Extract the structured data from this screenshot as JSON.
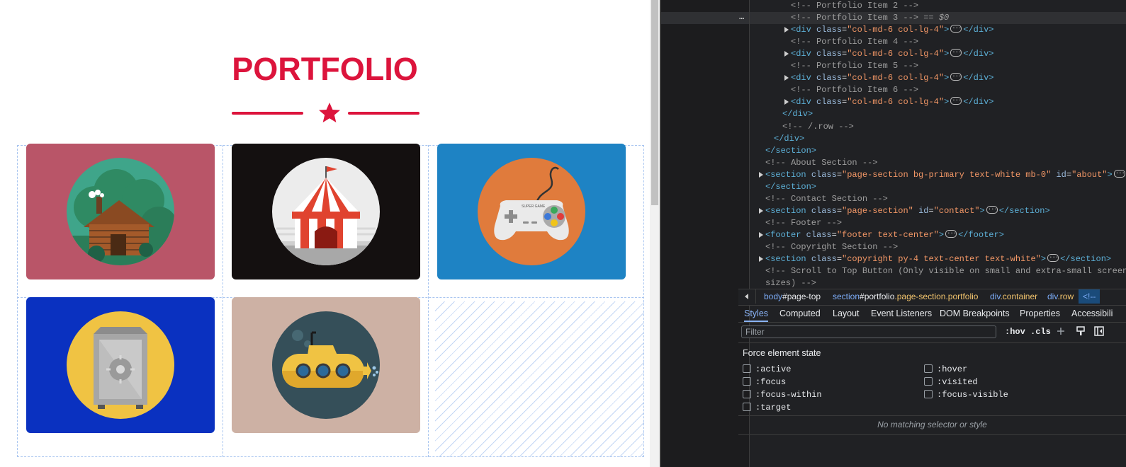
{
  "page": {
    "heading": "PORTFOLIO",
    "accent_color": "#dc143c",
    "divider_icon": "star-icon",
    "portfolio_items": [
      {
        "icon": "cabin-icon",
        "bg": "#b95568"
      },
      {
        "icon": "circus-tent-icon",
        "bg": "#141010"
      },
      {
        "icon": "game-controller-icon",
        "bg": "#1e83c4",
        "controller_text": "SUPER GAME"
      },
      {
        "icon": "safe-icon",
        "bg": "#0a31c0"
      },
      {
        "icon": "submarine-icon",
        "bg": "#cdb1a4"
      }
    ]
  },
  "devtools": {
    "dom_lines": [
      {
        "comment": "<!-- Portfolio Item 2 -->"
      },
      {
        "comment": "<!-- Portfolio Item 3 -->",
        "marker": "== $0"
      },
      {
        "open": "<div",
        "attr": "class",
        "value": "\"col-md-6 col-lg-4\"",
        "close": "</div>"
      },
      {
        "comment": "<!-- Portfolio Item 4 -->"
      },
      {
        "open": "<div",
        "attr": "class",
        "value": "\"col-md-6 col-lg-4\"",
        "close": "</div>"
      },
      {
        "comment": "<!-- Portfolio Item 5 -->"
      },
      {
        "open": "<div",
        "attr": "class",
        "value": "\"col-md-6 col-lg-4\"",
        "close": "</div>"
      },
      {
        "comment": "<!-- Portfolio Item 6 -->"
      },
      {
        "open": "<div",
        "attr": "class",
        "value": "\"col-md-6 col-lg-4\"",
        "close": "</div>"
      },
      {
        "tag": "</div>"
      },
      {
        "comment": "<!-- /.row -->"
      },
      {
        "tag": "</div>"
      },
      {
        "tag": "</section>"
      },
      {
        "comment": "<!-- About Section -->"
      },
      {
        "open": "<section",
        "attr": "class",
        "value": "\"page-section bg-primary text-white mb-0\"",
        "attr2": "id",
        "value2": "\"about\"",
        "close": ">"
      },
      {
        "tag": "</section>"
      },
      {
        "comment": "<!-- Contact Section -->"
      },
      {
        "open": "<section",
        "attr": "class",
        "value": "\"page-section\"",
        "attr2": "id",
        "value2": "\"contact\"",
        "close": "</section>"
      },
      {
        "comment": "<!-- Footer -->"
      },
      {
        "open": "<footer",
        "attr": "class",
        "value": "\"footer text-center\"",
        "close": "</footer>"
      },
      {
        "comment": "<!-- Copyright Section -->"
      },
      {
        "open": "<section",
        "attr": "class",
        "value": "\"copyright py-4 text-center text-white\"",
        "close": "</section>"
      },
      {
        "comment": "<!-- Scroll to Top Button (Only visible on small and extra-small screen"
      },
      {
        "comment": "sizes) -->"
      }
    ],
    "breadcrumbs": {
      "c1_el": "body",
      "c1_id": "#page-top",
      "c2_el": "section",
      "c2_id": "#portfolio",
      "c2_cl": ".page-section.portfolio",
      "c3_el": "div",
      "c3_cl": ".container",
      "c4_el": "div",
      "c4_cl": ".row",
      "c5": "<!--"
    },
    "tabs": [
      "Styles",
      "Computed",
      "Layout",
      "Event Listeners",
      "DOM Breakpoints",
      "Properties",
      "Accessibili"
    ],
    "filter_placeholder": "Filter",
    "hov_label": ":hov",
    "cls_label": ".cls",
    "force_title": "Force element state",
    "states_left": [
      ":active",
      ":focus",
      ":focus-within",
      ":target"
    ],
    "states_right": [
      ":hover",
      ":visited",
      ":focus-visible"
    ],
    "no_match": "No matching selector or style"
  }
}
